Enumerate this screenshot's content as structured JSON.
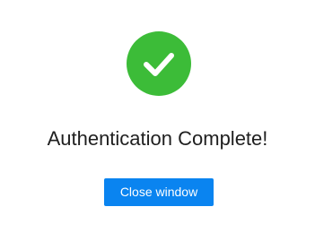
{
  "status": {
    "icon": "checkmark-icon",
    "color": "#3cbc38"
  },
  "message": {
    "title": "Authentication Complete!"
  },
  "actions": {
    "close_label": "Close window",
    "close_color": "#0a84f0"
  }
}
